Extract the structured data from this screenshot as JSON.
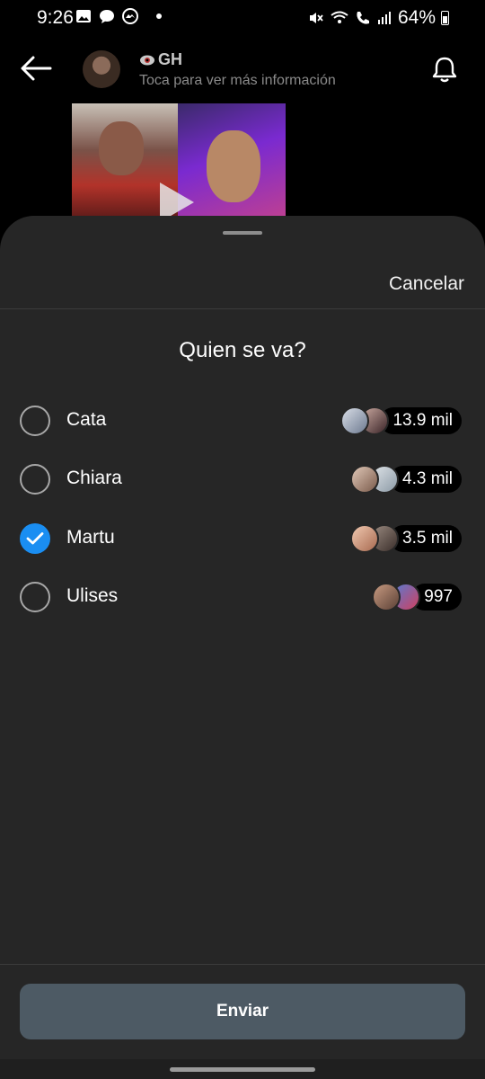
{
  "status_bar": {
    "time": "9:26",
    "battery": "64%",
    "left_icons": [
      "image-icon",
      "chat-bubble-icon",
      "messenger-icon"
    ],
    "right_icons": [
      "mute-icon",
      "wifi-call-icon",
      "call-icon",
      "signal-icon",
      "battery-icon"
    ]
  },
  "header": {
    "channel_name": "GH",
    "subtitle": "Toca para ver más información"
  },
  "sheet": {
    "cancel_label": "Cancelar",
    "question": "Quien se va?",
    "options": [
      {
        "label": "Cata",
        "votes": "13.9 mil",
        "selected": false
      },
      {
        "label": "Chiara",
        "votes": "4.3 mil",
        "selected": false
      },
      {
        "label": "Martu",
        "votes": "3.5 mil",
        "selected": true
      },
      {
        "label": "Ulises",
        "votes": "997",
        "selected": false
      }
    ],
    "send_label": "Enviar"
  },
  "colors": {
    "sheet_bg": "#262626",
    "accent": "#1a8ef2",
    "send_button": "#4d5a64"
  }
}
